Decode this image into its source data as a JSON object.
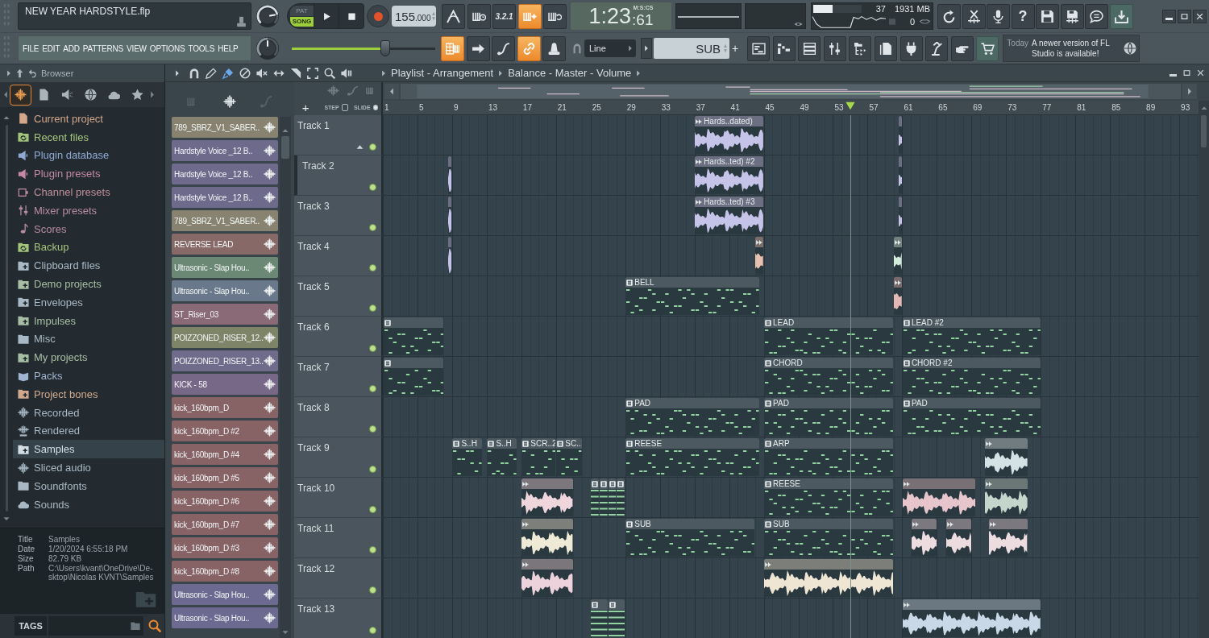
{
  "app_bar": {
    "project_title": "NEW YEAR HARDSTYLE.flp",
    "menu": [
      "FILE",
      "EDIT",
      "ADD",
      "PATTERNS",
      "VIEW",
      "OPTIONS",
      "TOOLS",
      "HELP"
    ],
    "master_volume_knob": {
      "level": 0.8
    },
    "master_pitch_knob": {
      "level": 0.5
    },
    "main_volume_slider": {
      "level": 0.65
    },
    "transport": {
      "modes": [
        {
          "label": "PAT",
          "selected": false
        },
        {
          "label": "SONG",
          "selected": true
        }
      ],
      "tempo": "155",
      "tempo_decimals": ".000"
    },
    "record_toggles": [
      {
        "kind": "metronome",
        "on": false
      },
      {
        "kind": "wait",
        "on": false
      },
      {
        "kind": "countdown",
        "label": "3.2.1",
        "on": false
      },
      {
        "kind": "typing",
        "on": true
      },
      {
        "kind": "loop",
        "on": false
      }
    ],
    "time": {
      "value": "1:23",
      "centiseconds": ":61",
      "format": "M:S:CS"
    },
    "monitor": {
      "cpu": "37",
      "cpu_meter": {
        "level": 0.4
      },
      "memory": "1931 MB",
      "polyphony": "0"
    },
    "tool_buttons": [
      {
        "kind": "undo",
        "highlighted": false
      },
      {
        "kind": "cut",
        "highlighted": false
      },
      {
        "kind": "record",
        "highlighted": false
      },
      {
        "kind": "help",
        "label": "?",
        "highlighted": false
      },
      {
        "kind": "save",
        "highlighted": false
      },
      {
        "kind": "export",
        "highlighted": false
      },
      {
        "kind": "chat",
        "highlighted": false
      },
      {
        "kind": "download",
        "highlighted": true
      }
    ],
    "edit_toggles": [
      {
        "kind": "pianoroll",
        "on": true
      },
      {
        "kind": "arrow",
        "on": false
      },
      {
        "kind": "curve",
        "on": false
      },
      {
        "kind": "link",
        "on": true
      },
      {
        "kind": "bell",
        "on": false
      }
    ],
    "snap": {
      "value": "Line"
    },
    "pattern": {
      "value": "SUB",
      "add_label": "+"
    },
    "window_buttons": [
      {
        "kind": "playlist",
        "highlighted": false
      },
      {
        "kind": "pianoroll",
        "highlighted": false
      },
      {
        "kind": "rack",
        "highlighted": false
      },
      {
        "kind": "mixer",
        "highlighted": false
      },
      {
        "kind": "browser",
        "highlighted": false
      },
      {
        "kind": "files",
        "highlighted": false
      },
      {
        "kind": "plugin",
        "highlighted": false
      },
      {
        "kind": "lamp",
        "highlighted": false
      },
      {
        "kind": "hand",
        "highlighted": false
      },
      {
        "kind": "cart",
        "highlighted": true
      }
    ],
    "hint": {
      "label": "Today",
      "message": "A newer version of FL Studio is available!"
    }
  },
  "browser": {
    "title": "Browser",
    "tabs": [
      {
        "selected": true
      },
      {
        "selected": false
      },
      {
        "selected": false
      },
      {
        "selected": false
      },
      {
        "selected": false
      },
      {
        "selected": false
      }
    ],
    "items": [
      {
        "name": "Current project",
        "kind": "project",
        "color": "#d4a68a",
        "selected": false
      },
      {
        "name": "Recent files",
        "kind": "sync",
        "color": "#a4c47c",
        "selected": false
      },
      {
        "name": "Plugin database",
        "kind": "plugin",
        "color": "#8fa9d4",
        "selected": false
      },
      {
        "name": "Plugin presets",
        "kind": "plugin",
        "color": "#c48aa2",
        "selected": false
      },
      {
        "name": "Channel presets",
        "kind": "channel",
        "color": "#c08d9c",
        "selected": false
      },
      {
        "name": "Mixer presets",
        "kind": "mixer",
        "color": "#b98c9f",
        "selected": false
      },
      {
        "name": "Scores",
        "kind": "score",
        "color": "#b98ca1",
        "selected": false
      },
      {
        "name": "Backup",
        "kind": "sync",
        "color": "#a4c47c",
        "selected": false
      },
      {
        "name": "Clipboard files",
        "kind": "addfolder",
        "color": "#a8b8c4",
        "selected": false
      },
      {
        "name": "Demo projects",
        "kind": "addfolder",
        "color": "#a8bea4",
        "selected": false
      },
      {
        "name": "Envelopes",
        "kind": "addfolder",
        "color": "#a8b8c4",
        "selected": false
      },
      {
        "name": "Impulses",
        "kind": "addfolder",
        "color": "#a8bea4",
        "selected": false
      },
      {
        "name": "Misc",
        "kind": "folder",
        "color": "#a8b8c4",
        "selected": false
      },
      {
        "name": "My projects",
        "kind": "addfolder",
        "color": "#a8bea4",
        "selected": false
      },
      {
        "name": "Packs",
        "kind": "pack",
        "color": "#9fb4d0",
        "selected": false
      },
      {
        "name": "Project bones",
        "kind": "addfolder",
        "color": "#d0a88c",
        "selected": false
      },
      {
        "name": "Recorded",
        "kind": "audio",
        "color": "#a8b8c4",
        "selected": false
      },
      {
        "name": "Rendered",
        "kind": "render",
        "color": "#a8b8c4",
        "selected": false
      },
      {
        "name": "Samples",
        "kind": "addfolder",
        "color": "#d2dee4",
        "selected": true
      },
      {
        "name": "Sliced audio",
        "kind": "audio",
        "color": "#a8b8c4",
        "selected": false
      },
      {
        "name": "Soundfonts",
        "kind": "folder",
        "color": "#a8b8c4",
        "selected": false
      },
      {
        "name": "Sounds",
        "kind": "cloud",
        "color": "#a8b8c4",
        "selected": false
      }
    ],
    "info": [
      {
        "label": "Title",
        "lines": [
          "Samples"
        ]
      },
      {
        "label": "Date",
        "lines": [
          "1/20/2024 6:55:18 PM"
        ]
      },
      {
        "label": "Size",
        "lines": [
          "82.79 KB"
        ]
      },
      {
        "label": "Path",
        "lines": [
          "C:\\Users\\kvant\\OneDrive\\De-",
          "sktop\\Nicolas KVNT\\Samples"
        ]
      }
    ],
    "tags_label": "TAGS"
  },
  "playlist": {
    "title": "Playlist - Arrangement",
    "breadcrumb": "Balance - Master - Volume",
    "tools": [
      {
        "selected": false
      },
      {
        "selected": false
      },
      {
        "selected": true
      },
      {
        "selected": false
      },
      {
        "selected": false
      },
      {
        "selected": false
      },
      {
        "selected": false
      },
      {
        "selected": false
      },
      {
        "selected": false
      },
      {
        "selected": false
      }
    ],
    "picker": {
      "filters": [
        {
          "selected": false
        },
        {
          "selected": true
        },
        {
          "selected": false
        }
      ],
      "channels": [
        {
          "name": "789_SBRZ_V1_SABER..",
          "color": "#878370"
        },
        {
          "name": "Hardstyle Voice _12 B..",
          "color": "#6d6a8c"
        },
        {
          "name": "Hardstyle Voice _12 B..",
          "color": "#6d6a8c"
        },
        {
          "name": "Hardstyle Voice _12 B..",
          "color": "#6d6a8c"
        },
        {
          "name": "789_SBRZ_V1_SABER..",
          "color": "#878370"
        },
        {
          "name": "REVERSE LEAD",
          "color": "#876a67"
        },
        {
          "name": "Ultrasonic - Slap Hou..",
          "color": "#6a8874"
        },
        {
          "name": "Ultrasonic - Slap Hou..",
          "color": "#69798b"
        },
        {
          "name": "ST_Riser_03",
          "color": "#896a76"
        },
        {
          "name": "POIZZONED_RISER_12..",
          "color": "#7d8467"
        },
        {
          "name": "POIZZONED_RISER_13..",
          "color": "#6f6b8a"
        },
        {
          "name": "KICK - 58",
          "color": "#786888"
        },
        {
          "name": "kick_160bpm_D",
          "color": "#876366"
        },
        {
          "name": "kick_160bpm_D #2",
          "color": "#876366"
        },
        {
          "name": "kick_160bpm_D #4",
          "color": "#876366"
        },
        {
          "name": "kick_160bpm_D #5",
          "color": "#876366"
        },
        {
          "name": "kick_160bpm_D #6",
          "color": "#876366"
        },
        {
          "name": "kick_160bpm_D #7",
          "color": "#876366"
        },
        {
          "name": "kick_160bpm_D #3",
          "color": "#876366"
        },
        {
          "name": "kick_160bpm_D #8",
          "color": "#876366"
        },
        {
          "name": "Ultrasonic - Slap Hou..",
          "color": "#6c6a90"
        },
        {
          "name": "Ultrasonic - Slap Hou..",
          "color": "#6c6a90"
        }
      ]
    },
    "step": {
      "label": "STEP",
      "checked": false
    },
    "slide": {
      "label": "SLIDE",
      "checked": true
    },
    "add_track_label": "+",
    "ruler": [
      "1",
      "5",
      "9",
      "13",
      "17",
      "21",
      "25",
      "29",
      "33",
      "37",
      "41",
      "45",
      "49",
      "53",
      "57",
      "61",
      "65",
      "69",
      "73",
      "77",
      "81",
      "85",
      "89",
      "93"
    ],
    "tracks": [
      {
        "name": "Track 1",
        "on": true,
        "expanded": true,
        "clips": [
          {
            "kind": "audio",
            "label": "Hards..dated)",
            "color": "#c6c3e8"
          },
          {
            "kind": "audio",
            "color": "#c6c3e8"
          }
        ],
        "children": [
          {
            "name": "Track 2",
            "on": true,
            "clips": [
              {
                "kind": "audio",
                "color": "#c6c3e8"
              },
              {
                "kind": "audio",
                "label": "Hards..ted) #2",
                "color": "#c6c3e8"
              },
              {
                "kind": "audio",
                "color": "#c6c3e8"
              }
            ]
          }
        ]
      },
      {
        "name": "Track 3",
        "on": true,
        "clips": [
          {
            "kind": "audio",
            "color": "#c6c3e8"
          },
          {
            "kind": "audio",
            "label": "Hards..ted) #3",
            "color": "#c6c3e8"
          },
          {
            "kind": "audio",
            "color": "#c6c3e8"
          }
        ]
      },
      {
        "name": "Track 4",
        "on": true,
        "clips": [
          {
            "kind": "audio",
            "color": "#c6c3e8"
          },
          {
            "kind": "audio",
            "color": "#e8c0b0"
          },
          {
            "kind": "audio",
            "color": "#d4ecdc"
          }
        ]
      },
      {
        "name": "Track 5",
        "on": true,
        "clips": [
          {
            "kind": "pattern",
            "label": "BELL"
          },
          {
            "kind": "audio",
            "color": "#e4b8b4"
          }
        ]
      },
      {
        "name": "Track 6",
        "on": true,
        "clips": [
          {
            "kind": "pattern"
          },
          {
            "kind": "pattern",
            "label": "LEAD"
          },
          {
            "kind": "pattern",
            "label": "LEAD #2"
          }
        ]
      },
      {
        "name": "Track 7",
        "on": true,
        "clips": [
          {
            "kind": "pattern"
          },
          {
            "kind": "pattern",
            "label": "CHORD"
          },
          {
            "kind": "pattern",
            "label": "CHORD #2"
          }
        ]
      },
      {
        "name": "Track 8",
        "on": true,
        "clips": [
          {
            "kind": "pattern",
            "label": "PAD"
          },
          {
            "kind": "pattern",
            "label": "PAD"
          },
          {
            "kind": "pattern",
            "label": "PAD"
          }
        ]
      },
      {
        "name": "Track 9",
        "on": true,
        "clips": [
          {
            "kind": "pattern",
            "label": "S..H"
          },
          {
            "kind": "pattern",
            "label": "S..H"
          },
          {
            "kind": "pattern",
            "label": "SCR..2"
          },
          {
            "kind": "pattern",
            "label": "SC.."
          },
          {
            "kind": "pattern",
            "label": "REESE"
          },
          {
            "kind": "pattern",
            "label": "ARP"
          },
          {
            "kind": "audio",
            "color": "#d4e2e6"
          }
        ]
      },
      {
        "name": "Track 10",
        "on": true,
        "clips": [
          {
            "kind": "audio",
            "color": "#eed6dc"
          },
          {
            "kind": "pattern"
          },
          {
            "kind": "pattern"
          },
          {
            "kind": "pattern"
          },
          {
            "kind": "pattern"
          },
          {
            "kind": "pattern",
            "label": "REESE"
          },
          {
            "kind": "audio",
            "color": "#e6c6cc"
          },
          {
            "kind": "audio",
            "color": "#c4d6cc"
          }
        ]
      },
      {
        "name": "Track 11",
        "on": true,
        "clips": [
          {
            "kind": "audio",
            "color": "#eeead6"
          },
          {
            "kind": "pattern",
            "label": "SUB"
          },
          {
            "kind": "pattern",
            "label": "SUB"
          },
          {
            "kind": "audio",
            "color": "#ecdce0"
          },
          {
            "kind": "audio",
            "color": "#ecdce0"
          },
          {
            "kind": "audio",
            "color": "#ecdce0"
          }
        ]
      },
      {
        "name": "Track 12",
        "on": true,
        "clips": [
          {
            "kind": "audio",
            "color": "#ecd2da"
          },
          {
            "kind": "audio",
            "color": "#eee6d2"
          }
        ]
      },
      {
        "name": "Track 13",
        "on": true,
        "clips": [
          {
            "kind": "pattern"
          },
          {
            "kind": "pattern"
          },
          {
            "kind": "audio",
            "color": "#c8d8e6"
          }
        ]
      }
    ]
  }
}
